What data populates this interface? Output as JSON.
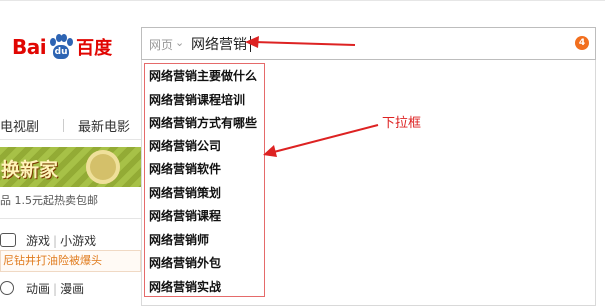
{
  "logo": {
    "latin": "Bai",
    "du": "du",
    "chinese": "百度"
  },
  "search": {
    "scope": "网页",
    "query": "网络营销",
    "badge_count": "4"
  },
  "dropdown": {
    "suggestions": [
      "网络营销主要做什么",
      "网络营销课程培训",
      "网络营销方式有哪些",
      "网络营销公司",
      "网络营销软件",
      "网络营销策划",
      "网络营销课程",
      "网络营销师",
      "网络营销外包",
      "网络营销实战"
    ]
  },
  "annotation": {
    "label": "下拉框",
    "color": "#dd2222"
  },
  "background": {
    "nav": {
      "left": "电视剧",
      "right": "最新电影"
    },
    "banner": {
      "text": "换新家"
    },
    "promo": "品 1.5元起热卖包邮",
    "games": {
      "a": "游戏",
      "b": "小游戏"
    },
    "news": "尼钻井打油险被爆头",
    "anime": {
      "a": "动画",
      "b": "漫画"
    }
  },
  "colors": {
    "brand_red": "#e10602",
    "brand_blue": "#2d64b3",
    "badge": "#f26f1e"
  }
}
